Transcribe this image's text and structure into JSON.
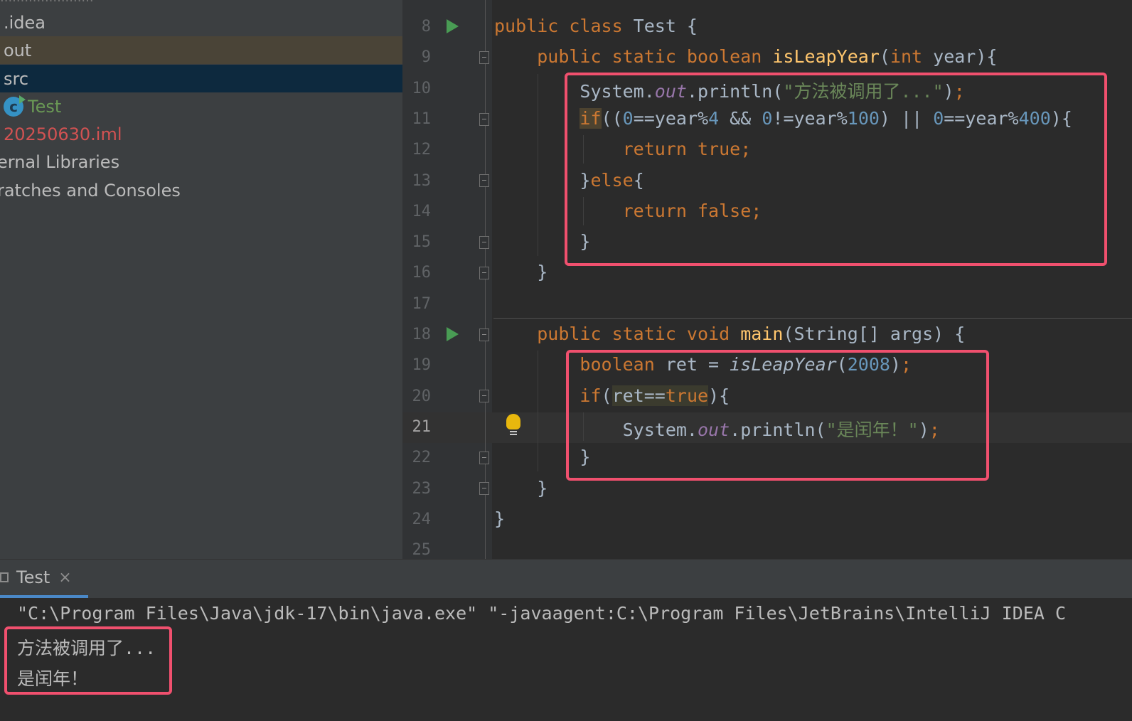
{
  "project": {
    "items": [
      {
        "label": ".idea"
      },
      {
        "label": "out"
      },
      {
        "label": "src"
      },
      {
        "label": "Test"
      },
      {
        "label": "20250630.iml"
      },
      {
        "label": "ernal Libraries"
      },
      {
        "label": "ratches and Consoles"
      }
    ]
  },
  "editor": {
    "lines": [
      {
        "n": "8",
        "t": [
          [
            "kw",
            "public class "
          ],
          [
            "pl",
            "Test {"
          ]
        ]
      },
      {
        "n": "9",
        "t": [
          [
            "pl",
            "    "
          ],
          [
            "kw",
            "public static boolean "
          ],
          [
            "fn",
            "isLeapYear"
          ],
          [
            "pl",
            "("
          ],
          [
            "kw",
            "int "
          ],
          [
            "pl",
            "year){"
          ]
        ]
      },
      {
        "n": "10",
        "t": [
          [
            "pl",
            "        System."
          ],
          [
            "pf",
            "out"
          ],
          [
            "pl",
            ".println("
          ],
          [
            "str",
            "\"方法被调用了...\""
          ],
          [
            "pl",
            ")"
          ],
          [
            "kw",
            ";"
          ]
        ]
      },
      {
        "n": "11",
        "t": [
          [
            "pl",
            "        "
          ],
          [
            "kw",
            "if"
          ],
          [
            "pl",
            "(("
          ],
          [
            "num",
            "0"
          ],
          [
            "pl",
            "==year%"
          ],
          [
            "num",
            "4"
          ],
          [
            "pl",
            " && "
          ],
          [
            "num",
            "0"
          ],
          [
            "pl",
            "!=year%"
          ],
          [
            "num",
            "100"
          ],
          [
            "pl",
            ") || "
          ],
          [
            "num",
            "0"
          ],
          [
            "pl",
            "==year%"
          ],
          [
            "num",
            "400"
          ],
          [
            "pl",
            "){"
          ]
        ]
      },
      {
        "n": "12",
        "t": [
          [
            "pl",
            "            "
          ],
          [
            "kw",
            "return true;"
          ]
        ]
      },
      {
        "n": "13",
        "t": [
          [
            "pl",
            "        }"
          ],
          [
            "kw",
            "else"
          ],
          [
            "pl",
            "{"
          ]
        ]
      },
      {
        "n": "14",
        "t": [
          [
            "pl",
            "            "
          ],
          [
            "kw",
            "return false;"
          ]
        ]
      },
      {
        "n": "15",
        "t": [
          [
            "pl",
            "        }"
          ]
        ]
      },
      {
        "n": "16",
        "t": [
          [
            "pl",
            "    }"
          ]
        ]
      },
      {
        "n": "17",
        "t": []
      },
      {
        "n": "18",
        "t": [
          [
            "pl",
            "    "
          ],
          [
            "kw",
            "public static void "
          ],
          [
            "fn",
            "main"
          ],
          [
            "pl",
            "(String[] args) {"
          ]
        ]
      },
      {
        "n": "19",
        "t": [
          [
            "pl",
            "        "
          ],
          [
            "kw",
            "boolean "
          ],
          [
            "pl",
            "ret = "
          ],
          [
            "it",
            "isLeapYear"
          ],
          [
            "pl",
            "("
          ],
          [
            "num",
            "2008"
          ],
          [
            "pl",
            ")"
          ],
          [
            "kw",
            ";"
          ]
        ]
      },
      {
        "n": "20",
        "t": [
          [
            "pl",
            "        "
          ],
          [
            "kw",
            "if"
          ],
          [
            "pl",
            "("
          ],
          [
            "pl",
            "ret=="
          ],
          [
            "kw",
            "true"
          ],
          [
            "pl",
            "){"
          ]
        ]
      },
      {
        "n": "21",
        "t": [
          [
            "pl",
            "            System."
          ],
          [
            "pf",
            "out"
          ],
          [
            "pl",
            ".println("
          ],
          [
            "str",
            "\"是闰年！\""
          ],
          [
            "pl",
            ")"
          ],
          [
            "kw",
            ";"
          ]
        ]
      },
      {
        "n": "22",
        "t": [
          [
            "pl",
            "        }"
          ]
        ]
      },
      {
        "n": "23",
        "t": [
          [
            "pl",
            "    }"
          ]
        ]
      },
      {
        "n": "24",
        "t": [
          [
            "pl",
            "}"
          ]
        ]
      },
      {
        "n": "25",
        "t": []
      }
    ]
  },
  "run": {
    "tab_label": "Test",
    "tab_close": "×",
    "console": [
      "\"C:\\Program Files\\Java\\jdk-17\\bin\\java.exe\" \"-javaagent:C:\\Program Files\\JetBrains\\IntelliJ IDEA C",
      "方法被调用了...",
      "是闰年！"
    ]
  },
  "colors": {
    "keyword": "#cc7832",
    "function": "#ffc66d",
    "string": "#6a8759",
    "number": "#6897bb",
    "static_field": "#9876aa",
    "annotation_box": "#f0506e"
  }
}
